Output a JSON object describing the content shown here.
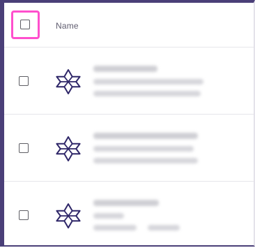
{
  "table": {
    "header": {
      "name_label": "Name"
    },
    "rows": [
      {
        "icon": "star-of-david-outline-icon"
      },
      {
        "icon": "star-of-david-outline-icon"
      },
      {
        "icon": "star-of-david-outline-icon"
      }
    ]
  },
  "colors": {
    "highlight": "#ff4fcd",
    "icon": "#2e2668",
    "frame": "#4a3f78"
  }
}
